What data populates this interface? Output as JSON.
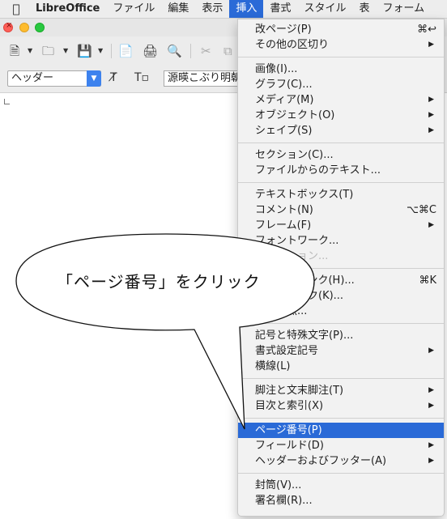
{
  "menubar": {
    "app_name": "LibreOffice",
    "items": [
      "ファイル",
      "編集",
      "表示",
      "挿入",
      "書式",
      "スタイル",
      "表",
      "フォーム"
    ],
    "active_index": 3
  },
  "toolbar": {
    "paragraph_style": "ヘッダー",
    "font_name": "源暎こぶり明朝"
  },
  "insert_menu": {
    "items": [
      {
        "label": "改ページ(P)",
        "shortcut": "⌘↩"
      },
      {
        "label": "その他の区切り",
        "submenu": true
      },
      {
        "separator": true
      },
      {
        "label": "画像(I)..."
      },
      {
        "label": "グラフ(C)..."
      },
      {
        "label": "メディア(M)",
        "submenu": true
      },
      {
        "label": "オブジェクト(O)",
        "submenu": true
      },
      {
        "label": "シェイプ(S)",
        "submenu": true
      },
      {
        "separator": true
      },
      {
        "label": "セクション(C)..."
      },
      {
        "label": "ファイルからのテキスト..."
      },
      {
        "separator": true
      },
      {
        "label": "テキストボックス(T)"
      },
      {
        "label": "コメント(N)",
        "shortcut": "⌥⌘C"
      },
      {
        "label": "フレーム(F)",
        "submenu": true
      },
      {
        "label": "フォントワーク..."
      },
      {
        "label": "キャプション...",
        "disabled": true
      },
      {
        "separator": true
      },
      {
        "label": "ハイパーリンク(H)...",
        "shortcut": "⌘K"
      },
      {
        "label": "ブックマーク(K)..."
      },
      {
        "label": "相互参照..."
      },
      {
        "separator": true
      },
      {
        "label": "記号と特殊文字(P)..."
      },
      {
        "label": "書式設定記号",
        "submenu": true
      },
      {
        "label": "横線(L)"
      },
      {
        "separator": true
      },
      {
        "label": "脚注と文末脚注(T)",
        "submenu": true
      },
      {
        "label": "目次と索引(X)",
        "submenu": true
      },
      {
        "separator": true
      },
      {
        "label": "ページ番号(P)",
        "highlighted": true
      },
      {
        "label": "フィールド(D)",
        "submenu": true
      },
      {
        "label": "ヘッダーおよびフッター(A)",
        "submenu": true
      },
      {
        "separator": true
      },
      {
        "label": "封筒(V)..."
      },
      {
        "label": "署名欄(R)..."
      }
    ]
  },
  "callout": {
    "text": "「ページ番号」をクリック"
  },
  "colors": {
    "highlight": "#2a6ad7",
    "menu_bg": "#f2f2f2",
    "callout_fill": "#ffffff"
  }
}
